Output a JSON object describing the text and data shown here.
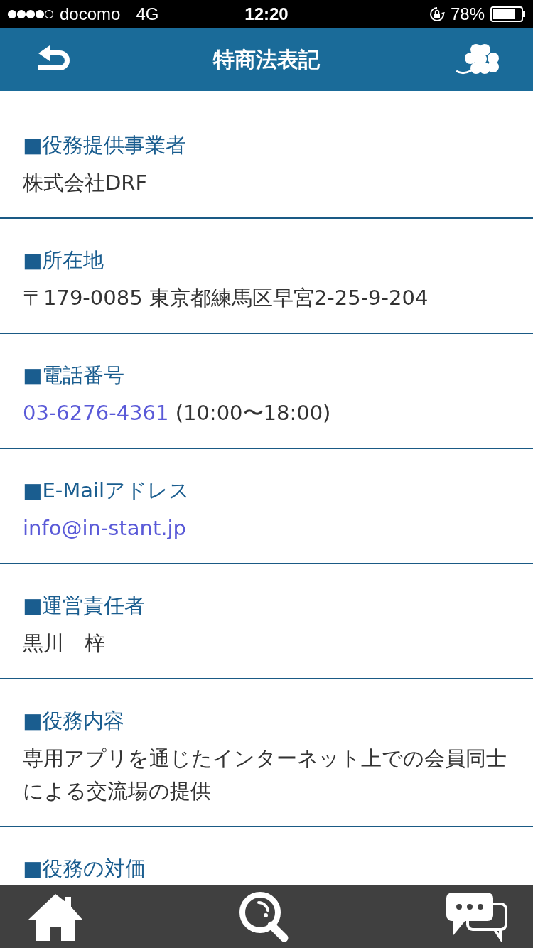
{
  "status_bar": {
    "carrier": "docomo",
    "network": "4G",
    "time": "12:20",
    "battery": "78%"
  },
  "header": {
    "title": "特商法表記"
  },
  "sections": [
    {
      "heading": "■役務提供事業者",
      "value": [
        {
          "text": "株式会社DRF",
          "link": false
        }
      ]
    },
    {
      "heading": "■所在地",
      "value": [
        {
          "text": "〒179-0085 東京都練馬区早宮2-25-9-204",
          "link": false
        }
      ]
    },
    {
      "heading": "■電話番号",
      "value": [
        {
          "text": "03-6276-4361",
          "link": true
        },
        {
          "text": " (10:00〜18:00)",
          "link": false
        }
      ]
    },
    {
      "heading": "■E-Mailアドレス",
      "value": [
        {
          "text": "info@in-stant.jp",
          "link": true
        }
      ]
    },
    {
      "heading": "■運営責任者",
      "value": [
        {
          "text": "黒川　梓",
          "link": false
        }
      ]
    },
    {
      "heading": "■役務内容",
      "value": [
        {
          "text": "専用アプリを通じたインターネット上での会員同士による交流場の提供",
          "link": false
        }
      ]
    },
    {
      "heading": "■役務の対価"
    }
  ]
}
